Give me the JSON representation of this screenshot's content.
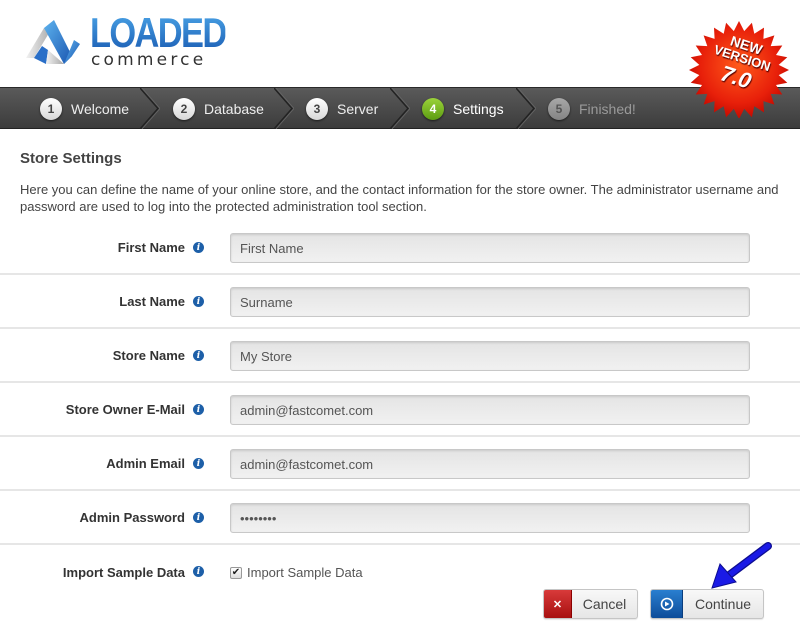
{
  "header": {
    "logo": {
      "word": "LOADED",
      "sub": "commerce",
      "icon": "loaded-commerce-logo-icon"
    },
    "badge": {
      "line1": "NEW",
      "line2": "VERSION",
      "number": "7.0",
      "color": "#e01a0a"
    }
  },
  "steps": [
    {
      "num": "1",
      "label": "Welcome",
      "state": "done"
    },
    {
      "num": "2",
      "label": "Database",
      "state": "done"
    },
    {
      "num": "3",
      "label": "Server",
      "state": "done"
    },
    {
      "num": "4",
      "label": "Settings",
      "state": "active"
    },
    {
      "num": "5",
      "label": "Finished!",
      "state": "disabled"
    }
  ],
  "main": {
    "title": "Store Settings",
    "description": "Here you can define the name of your online store, and the contact information for the store owner. The administrator username and password are used to log into the protected administration tool section.",
    "fields": [
      {
        "label": "First Name",
        "value": "",
        "placeholder": "First Name",
        "type": "text"
      },
      {
        "label": "Last Name",
        "value": "",
        "placeholder": "Surname",
        "type": "text"
      },
      {
        "label": "Store Name",
        "value": "",
        "placeholder": "My Store",
        "type": "text"
      },
      {
        "label": "Store Owner E-Mail",
        "value": "admin@fastcomet.com",
        "placeholder": "",
        "type": "text"
      },
      {
        "label": "Admin Email",
        "value": "admin@fastcomet.com",
        "placeholder": "",
        "type": "text"
      },
      {
        "label": "Admin Password",
        "value": "secret12",
        "placeholder": "",
        "type": "password"
      }
    ],
    "import_sample": {
      "label": "Import Sample Data",
      "checkbox_label": "Import Sample Data",
      "checked": true
    }
  },
  "buttons": {
    "cancel": {
      "label": "Cancel",
      "icon": "x-icon",
      "color": "#c01f1f"
    },
    "continue": {
      "label": "Continue",
      "icon": "arrow-circle-icon",
      "color": "#1a62b5"
    }
  },
  "annotation": {
    "arrow_color": "#1414e0"
  }
}
